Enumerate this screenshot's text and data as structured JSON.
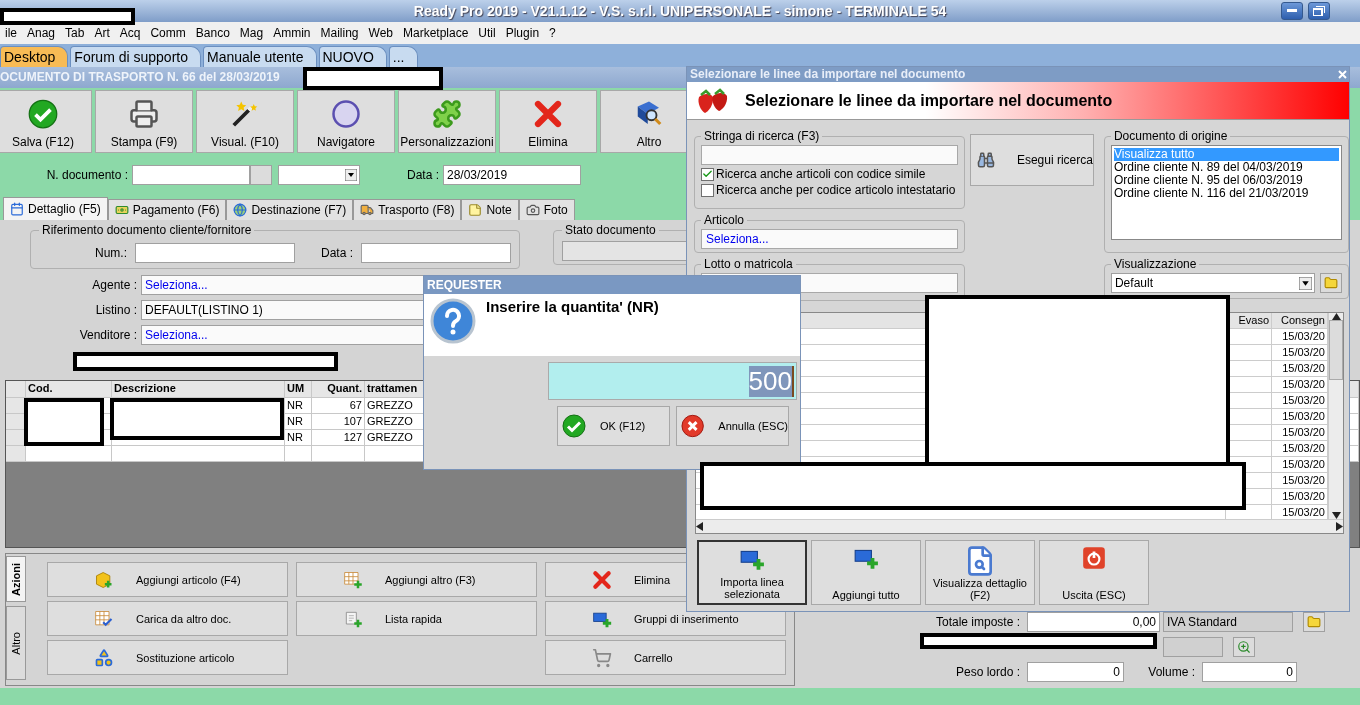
{
  "window": {
    "title": "Ready Pro 2019 - V21.1.12 - V.S. s.r.l. UNIPERSONALE - simone - TERMINALE 54"
  },
  "menu": [
    "ile",
    "Anag",
    "Tab",
    "Art",
    "Acq",
    "Comm",
    "Banco",
    "Mag",
    "Ammin",
    "Mailing",
    "Web",
    "Marketplace",
    "Util",
    "Plugin",
    "?"
  ],
  "tabs": [
    {
      "label": "Desktop",
      "selected": true
    },
    {
      "label": "Forum di supporto",
      "selected": false
    },
    {
      "label": "Manuale utente",
      "selected": false
    },
    {
      "label": "NUOVO",
      "selected": false
    },
    {
      "label": "...",
      "selected": false
    }
  ],
  "document_title": "OCUMENTO DI TRASPORTO N. 66 del 28/03/2019",
  "toolbar": [
    {
      "label": "Salva (F12)",
      "kind": "save"
    },
    {
      "label": "Stampa (F9)",
      "kind": "print"
    },
    {
      "label": "Visual. (F10)",
      "kind": "wand"
    },
    {
      "label": "Navigatore",
      "kind": "compass"
    },
    {
      "label": "Personalizzazioni",
      "kind": "puzzle"
    },
    {
      "label": "Elimina",
      "kind": "delete"
    },
    {
      "label": "Altro",
      "kind": "book"
    }
  ],
  "header": {
    "number_label": "N. documento :",
    "date_label": "Data :",
    "date": "28/03/2019"
  },
  "section_tabs": [
    {
      "label": "Dettaglio (F5)",
      "kind": "calendar",
      "selected": true
    },
    {
      "label": "Pagamento (F6)",
      "kind": "payment",
      "selected": false
    },
    {
      "label": "Destinazione (F7)",
      "kind": "globe",
      "selected": false
    },
    {
      "label": "Trasporto (F8)",
      "kind": "truck",
      "selected": false
    },
    {
      "label": "Note",
      "kind": "note",
      "selected": false
    },
    {
      "label": "Foto",
      "kind": "camera",
      "selected": false
    }
  ],
  "reference": {
    "title": "Riferimento documento cliente/fornitore",
    "num_label": "Num.:",
    "date_label": "Data :"
  },
  "status": {
    "title": "Stato documento"
  },
  "fields": [
    {
      "label": "Agente :",
      "value": "Seleziona...",
      "kind": "link"
    },
    {
      "label": "Listino :",
      "value": "DEFAULT(LISTINO 1)",
      "kind": "text"
    },
    {
      "label": "Venditore :",
      "value": "Seleziona...",
      "kind": "link"
    }
  ],
  "lines": {
    "columns": [
      "Cod.",
      "Descrizione",
      "UM",
      "Quant.",
      "trattamen"
    ],
    "rows": [
      {
        "um": "NR",
        "quantity": "67",
        "treatment": "GREZZO"
      },
      {
        "um": "NR",
        "quantity": "107",
        "treatment": "GREZZO"
      },
      {
        "um": "NR",
        "quantity": "127",
        "treatment": "GREZZO"
      }
    ]
  },
  "actions": {
    "tabs": [
      {
        "label": "Azioni",
        "selected": true
      },
      {
        "label": "Altro",
        "selected": false
      }
    ],
    "columns": [
      [
        {
          "label": "Aggiungi articolo (F4)",
          "kind": "add-box"
        },
        {
          "label": "Carica da altro doc.",
          "kind": "load-doc"
        },
        {
          "label": "Sostituzione articolo",
          "kind": "replace"
        }
      ],
      [
        {
          "label": "Aggiungi altro (F3)",
          "kind": "add-grid"
        },
        {
          "label": "Lista rapida",
          "kind": "list"
        }
      ],
      [
        {
          "label": "Elimina",
          "kind": "delete"
        },
        {
          "label": "Gruppi di inserimento",
          "kind": "groups"
        },
        {
          "label": "Carrello",
          "kind": "cart"
        }
      ]
    ]
  },
  "totals": {
    "tax_label": "Totale imposte :",
    "tax": "0,00",
    "vat": "IVA Standard",
    "weight_label": "Peso lordo :",
    "weight": "0",
    "volume_label": "Volume :",
    "volume": "0"
  },
  "import_dialog": {
    "title": "Selezionare le linee da importare nel documento",
    "heading": "Selezionare le linee da importare nel documento",
    "search_label": "Stringa di ricerca (F3)",
    "options": [
      {
        "label": "Ricerca anche articoli con codice simile",
        "checked": true
      },
      {
        "label": "Ricerca anche per codice articolo intestatario",
        "checked": false
      }
    ],
    "article_label": "Articolo",
    "article_value": "Seleziona...",
    "lot_label": "Lotto o matricola",
    "search_button": "Esegui ricerca",
    "origin_label": "Documento di origine",
    "origins": [
      {
        "label": "Visualizza tutto",
        "selected": true
      },
      {
        "label": "Ordine cliente N. 89 del 04/03/2019",
        "selected": false
      },
      {
        "label": "Ordine cliente N. 95 del 06/03/2019",
        "selected": false
      },
      {
        "label": "Ordine cliente N. 116 del 21/03/2019",
        "selected": false
      }
    ],
    "view_label": "Visualizzazione",
    "view_value": "Default",
    "columns": [
      "Evaso",
      "Consegn"
    ],
    "rows": [
      "15/03/20",
      "15/03/20",
      "15/03/20",
      "15/03/20",
      "15/03/20",
      "15/03/20",
      "15/03/20",
      "15/03/20",
      "15/03/20",
      "15/03/20",
      "15/03/20",
      "15/03/20"
    ],
    "buttons": [
      {
        "label": "Importa linea selezionata",
        "kind": "import"
      },
      {
        "label": "Aggiungi tutto",
        "kind": "add-all"
      },
      {
        "label": "Visualizza dettaglio (F2)",
        "kind": "detail"
      },
      {
        "label": "Uscita (ESC)",
        "kind": "exit"
      }
    ]
  },
  "requester": {
    "title": "REQUESTER",
    "message": "Inserire la quantita' (NR)",
    "value": "500",
    "buttons": [
      {
        "label": "OK (F12)",
        "kind": "save"
      },
      {
        "label": "Annulla (ESC)",
        "kind": "cancel"
      }
    ]
  }
}
